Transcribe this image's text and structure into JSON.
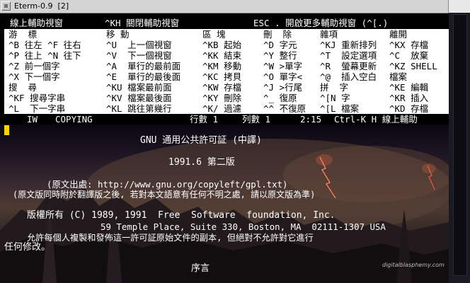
{
  "window": {
    "title": "Eterm-0.9  [2]"
  },
  "help": {
    "title_left": "線上輔助視窗",
    "title_mid": "^KH 關閉輔助視窗",
    "title_right": "ESC . 開啟更多輔助視窗 (^[.)",
    "headers": [
      "游  標",
      "移 動",
      "區 塊",
      "刪  除",
      "雜項",
      "離開"
    ],
    "rows": [
      [
        "^B 往左 ^F 往右",
        "^U  上一個視窗",
        "^KB 起始",
        "^D 字元",
        "^KJ 重新排列",
        "^KX 存檔"
      ],
      [
        "^P 往上 ^N 往下",
        "^V  下一個視窗",
        "^KK 結束",
        "^Y 整行",
        "^T  設定選項",
        "^C  放棄"
      ],
      [
        "^Z 前一個字",
        "^A  單行的最前面",
        "^KM 移動",
        "^W >單字",
        "^R  螢幕更新",
        "^KZ SHELL"
      ],
      [
        "^X 下一個字",
        "^E  單行的最後面",
        "^KC 拷貝",
        "^O 單字<",
        "^@  插入空白",
        "檔案"
      ],
      [
        "搜  尋",
        "^KU 檔案最前面",
        "^KW 存檔",
        "^J >行尾",
        "拼  字",
        "^KE 編輯"
      ],
      [
        "^KF 搜尋字串",
        "^KV 檔案最後面",
        "^KY 刪除",
        "^_ 復原",
        "^[N 字",
        "^KR 插入"
      ],
      [
        "^L  下一字串",
        "^KL 跳往第幾行",
        "^K/ 過濾",
        "^^ 不復原",
        "^[L 檔案",
        "^KD 存檔"
      ]
    ],
    "status": {
      "mode": "IW",
      "file": "COPYING",
      "row_label": "行數 1",
      "col_label": "列數 1",
      "time": "2:15",
      "hint": "Ctrl-K H 線上輔助"
    }
  },
  "document": {
    "title": "GNU 通用公共許可証 (中譯)",
    "version": "1991.6 第二版",
    "source": "(原文出處: http://www.gnu.org/copyleft/gpl.txt)",
    "disclaimer": "(原文版同時附於翻譯版之後, 若對本文語意有任何不明之處, 請以原文版為準)",
    "copyright1": "版權所有 (C) 1989, 1991  Free  Software  foundation, Inc.",
    "copyright2": "59 Temple Place, Suite 330, Boston, MA  02111-1307 USA",
    "permission1": "允許每個人複製和發佈這一許可証原始文件的副本, 但絕對不允許對它進行",
    "permission2": "任何修改。",
    "preamble": "序言"
  },
  "background_credit": "digitalblasphemy.com"
}
